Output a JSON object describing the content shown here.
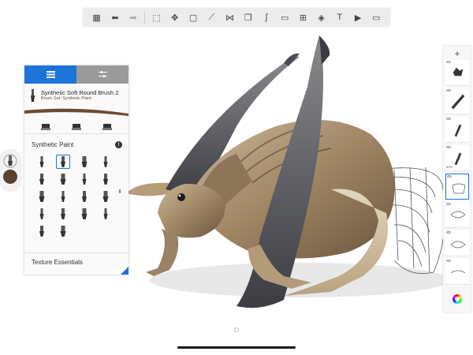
{
  "toolbar": {
    "tools": [
      {
        "name": "gallery-icon",
        "glyph": "▦"
      },
      {
        "name": "undo-icon",
        "glyph": "⬅"
      },
      {
        "name": "redo-icon",
        "glyph": "➡"
      },
      {
        "name": "selection-icon",
        "glyph": "⬚"
      },
      {
        "name": "transform-icon",
        "glyph": "✥"
      },
      {
        "name": "crop-icon",
        "glyph": "▢"
      },
      {
        "name": "ruler-icon",
        "glyph": "⟋"
      },
      {
        "name": "symmetry-icon",
        "glyph": "⋈"
      },
      {
        "name": "stencils-icon",
        "glyph": "❒"
      },
      {
        "name": "curves-icon",
        "glyph": "∫"
      },
      {
        "name": "image-icon",
        "glyph": "▭"
      },
      {
        "name": "perspective-icon",
        "glyph": "⊞"
      },
      {
        "name": "fill-icon",
        "glyph": "◈"
      },
      {
        "name": "text-icon",
        "glyph": "T"
      },
      {
        "name": "timelapse-icon",
        "glyph": "▶"
      },
      {
        "name": "fullscreen-icon",
        "glyph": "▭"
      }
    ]
  },
  "brush_panel": {
    "brush_name": "Synthetic Soft Round Brush 2",
    "brush_set_line": "Brush Set: Synthetic Paint",
    "set_title": "Synthetic Paint",
    "info_glyph": "!",
    "next_set_title": "Texture Essentials",
    "selected_index": 1,
    "brush_count": 18,
    "accent_color": "#1e73d8"
  },
  "layers": {
    "add_glyph": "+",
    "layer_label": "85%",
    "active_index": 4
  },
  "colors": {
    "current_color": "#5a4130",
    "accent": "#1e73d8"
  }
}
